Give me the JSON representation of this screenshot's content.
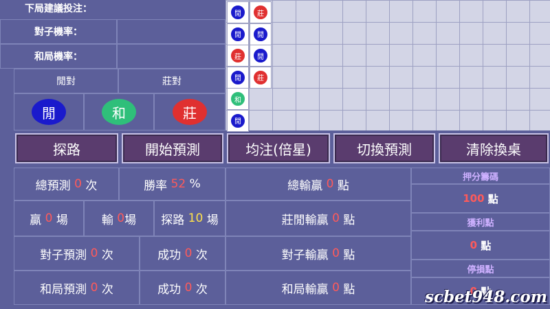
{
  "top": {
    "suggest_label": "下局建議投注：",
    "pair_rate_label": "對子機率：",
    "tie_rate_label": "和局機率：",
    "player_pair": "閒對",
    "banker_pair": "莊對",
    "player": "閒",
    "tie": "和",
    "banker": "莊"
  },
  "road": {
    "cells": [
      {
        "col": 0,
        "row": 0,
        "type": "player",
        "label": "閒"
      },
      {
        "col": 1,
        "row": 0,
        "type": "banker",
        "label": "莊"
      },
      {
        "col": 0,
        "row": 1,
        "type": "player",
        "label": "閒"
      },
      {
        "col": 1,
        "row": 1,
        "type": "player",
        "label": "閒"
      },
      {
        "col": 0,
        "row": 2,
        "type": "banker",
        "label": "莊"
      },
      {
        "col": 1,
        "row": 2,
        "type": "player",
        "label": "閒"
      },
      {
        "col": 0,
        "row": 3,
        "type": "player",
        "label": "閒"
      },
      {
        "col": 1,
        "row": 3,
        "type": "banker",
        "label": "莊"
      },
      {
        "col": 0,
        "row": 4,
        "type": "tie",
        "label": "和"
      },
      {
        "col": 0,
        "row": 5,
        "type": "player",
        "label": "閒"
      }
    ]
  },
  "buttons": {
    "probe": "探路",
    "start": "開始預測",
    "flat": "均注(倍星)",
    "switch": "切換預測",
    "clear": "清除換桌"
  },
  "stats": {
    "total_pred_label": "總預測",
    "total_pred_val": "0",
    "times": "次",
    "win_rate_label": "勝率",
    "win_rate_val": "52",
    "percent": "%",
    "total_winloss_label": "總輸贏",
    "total_winloss_val": "0",
    "points": "點",
    "win_label": "贏",
    "win_val": "0",
    "games": "場",
    "lose_label": "輸",
    "lose_val": "0",
    "probe_label": "探路",
    "probe_val": "10",
    "bp_winloss_label": "莊閒輸贏",
    "bp_winloss_val": "0",
    "pair_pred_label": "對子預測",
    "pair_pred_val": "0",
    "success_label": "成功",
    "pair_success_val": "0",
    "pair_winloss_label": "對子輸贏",
    "pair_winloss_val": "0",
    "tie_pred_label": "和局預測",
    "tie_pred_val": "0",
    "tie_success_val": "0",
    "tie_winloss_label": "和局輸贏",
    "tie_winloss_val": "0"
  },
  "side": {
    "bet_label": "押分籌碼",
    "bet_val": "100",
    "profit_label": "獲利點",
    "profit_val": "0",
    "stop_label": "停損點",
    "stop_val": "0",
    "points": "點"
  },
  "watermark": "scbet948.com",
  "colors": {
    "player": "#1a1acc",
    "banker": "#e03030",
    "tie": "#2fbf7a",
    "button_bg": "#5a3c6e"
  }
}
